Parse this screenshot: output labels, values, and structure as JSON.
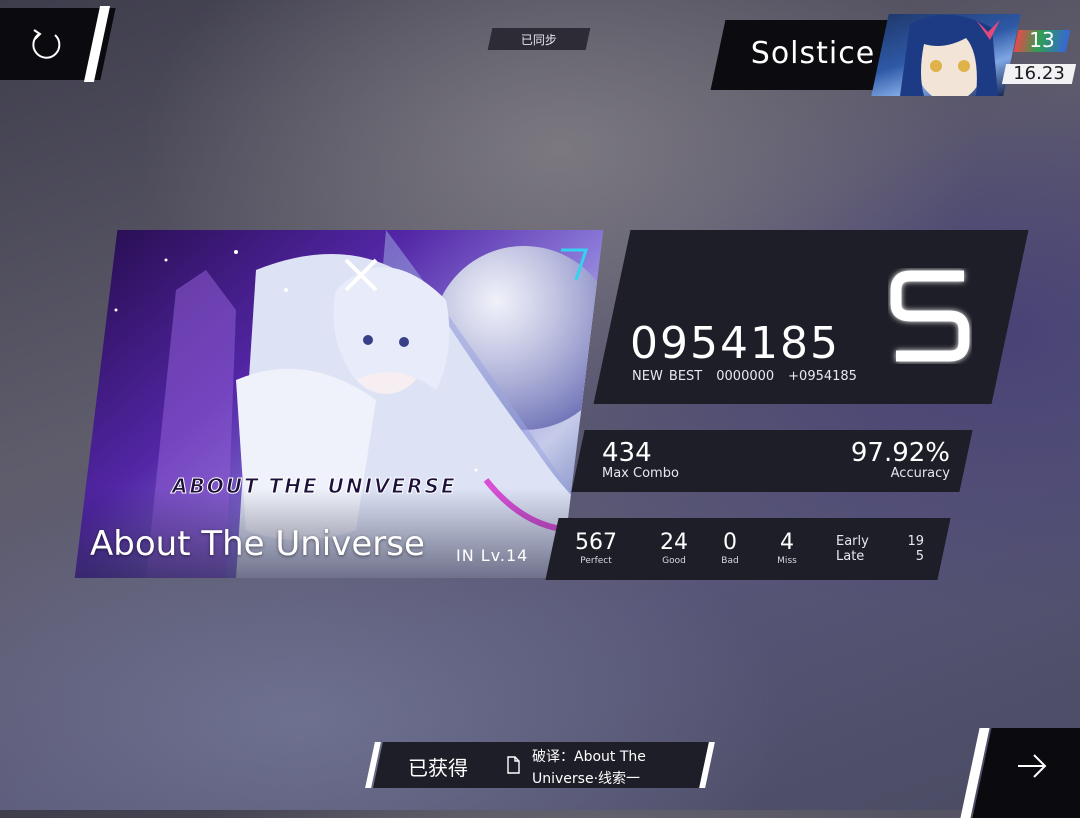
{
  "header": {
    "retry_icon": "retry-icon",
    "sync_status": "已同步"
  },
  "player": {
    "name": "Solstice",
    "level": "13",
    "rks": "16.23",
    "level_colors": [
      "#e84a4a",
      "#2f9e52",
      "#3667d9"
    ]
  },
  "song": {
    "title": "About The Universe",
    "logo_text": "ABOUT THE UNIVERSE",
    "difficulty": "IN Lv.14"
  },
  "result": {
    "score": "0954185",
    "new_best_label": "NEW BEST",
    "previous_best": "0000000",
    "delta": "+0954185",
    "grade": "S",
    "max_combo": "434",
    "max_combo_label": "Max Combo",
    "accuracy": "97.92%",
    "accuracy_label": "Accuracy"
  },
  "judgements": {
    "perfect": "567",
    "perfect_label": "Perfect",
    "good": "24",
    "good_label": "Good",
    "bad": "0",
    "bad_label": "Bad",
    "miss": "4",
    "miss_label": "Miss",
    "early_label": "Early",
    "early": "19",
    "late_label": "Late",
    "late": "5"
  },
  "obtained": {
    "label": "已获得",
    "item_line1": "破译：About The",
    "item_line2": "Universe·线索一"
  },
  "footer": {
    "next_icon": "arrow-right-icon"
  }
}
